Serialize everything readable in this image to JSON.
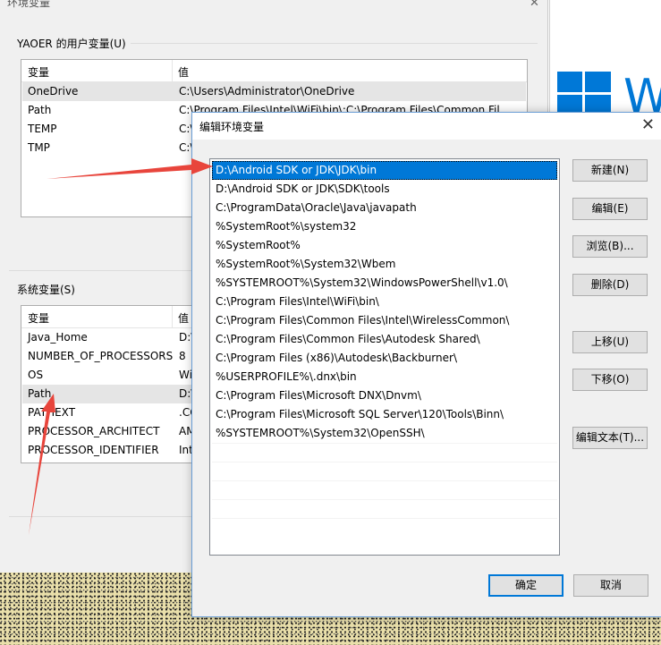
{
  "env_window": {
    "title": "环境变量",
    "user_vars": {
      "group_label": "YAOER 的用户变量(U)",
      "col_var": "变量",
      "col_val": "值",
      "rows": [
        {
          "name": "OneDrive",
          "value": "C:\\Users\\Administrator\\OneDrive"
        },
        {
          "name": "Path",
          "value": "C:\\Program Files\\Intel\\WiFi\\bin\\;C:\\Program Files\\Common Fil"
        },
        {
          "name": "TEMP",
          "value": "C:\\"
        },
        {
          "name": "TMP",
          "value": "C:\\"
        }
      ]
    },
    "system_vars": {
      "group_label": "系统变量(S)",
      "col_var": "变量",
      "col_val": "值",
      "rows": [
        {
          "name": "Java_Home",
          "value": "D:\\"
        },
        {
          "name": "NUMBER_OF_PROCESSORS",
          "value": "8"
        },
        {
          "name": "OS",
          "value": "Wi"
        },
        {
          "name": "Path",
          "value": "D:\\"
        },
        {
          "name": "PATHEXT",
          "value": ".CO"
        },
        {
          "name": "PROCESSOR_ARCHITECT",
          "value": "AM"
        },
        {
          "name": "PROCESSOR_IDENTIFIER",
          "value": "Int"
        }
      ]
    }
  },
  "desktop": {
    "brand_text": "W",
    "accent": "#0078d7"
  },
  "dialog": {
    "title": "编辑环境变量",
    "entries": [
      "D:\\Android SDK or JDK\\JDK\\bin",
      "D:\\Android SDK or JDK\\SDK\\tools",
      "C:\\ProgramData\\Oracle\\Java\\javapath",
      "%SystemRoot%\\system32",
      "%SystemRoot%",
      "%SystemRoot%\\System32\\Wbem",
      "%SYSTEMROOT%\\System32\\WindowsPowerShell\\v1.0\\",
      "C:\\Program Files\\Intel\\WiFi\\bin\\",
      "C:\\Program Files\\Common Files\\Intel\\WirelessCommon\\",
      "C:\\Program Files\\Common Files\\Autodesk Shared\\",
      "C:\\Program Files (x86)\\Autodesk\\Backburner\\",
      "%USERPROFILE%\\.dnx\\bin",
      "C:\\Program Files\\Microsoft DNX\\Dnvm\\",
      "C:\\Program Files\\Microsoft SQL Server\\120\\Tools\\Binn\\",
      "%SYSTEMROOT%\\System32\\OpenSSH\\"
    ],
    "selected_index": 0,
    "buttons": {
      "new": "新建(N)",
      "edit": "编辑(E)",
      "browse": "浏览(B)...",
      "delete": "删除(D)",
      "move_up": "上移(U)",
      "move_down": "下移(O)",
      "edit_text": "编辑文本(T)...",
      "ok": "确定",
      "cancel": "取消"
    },
    "close_glyph": "✕",
    "selection_color": "#0078d7"
  },
  "annotation": {
    "arrow_color": "#e8453c"
  }
}
